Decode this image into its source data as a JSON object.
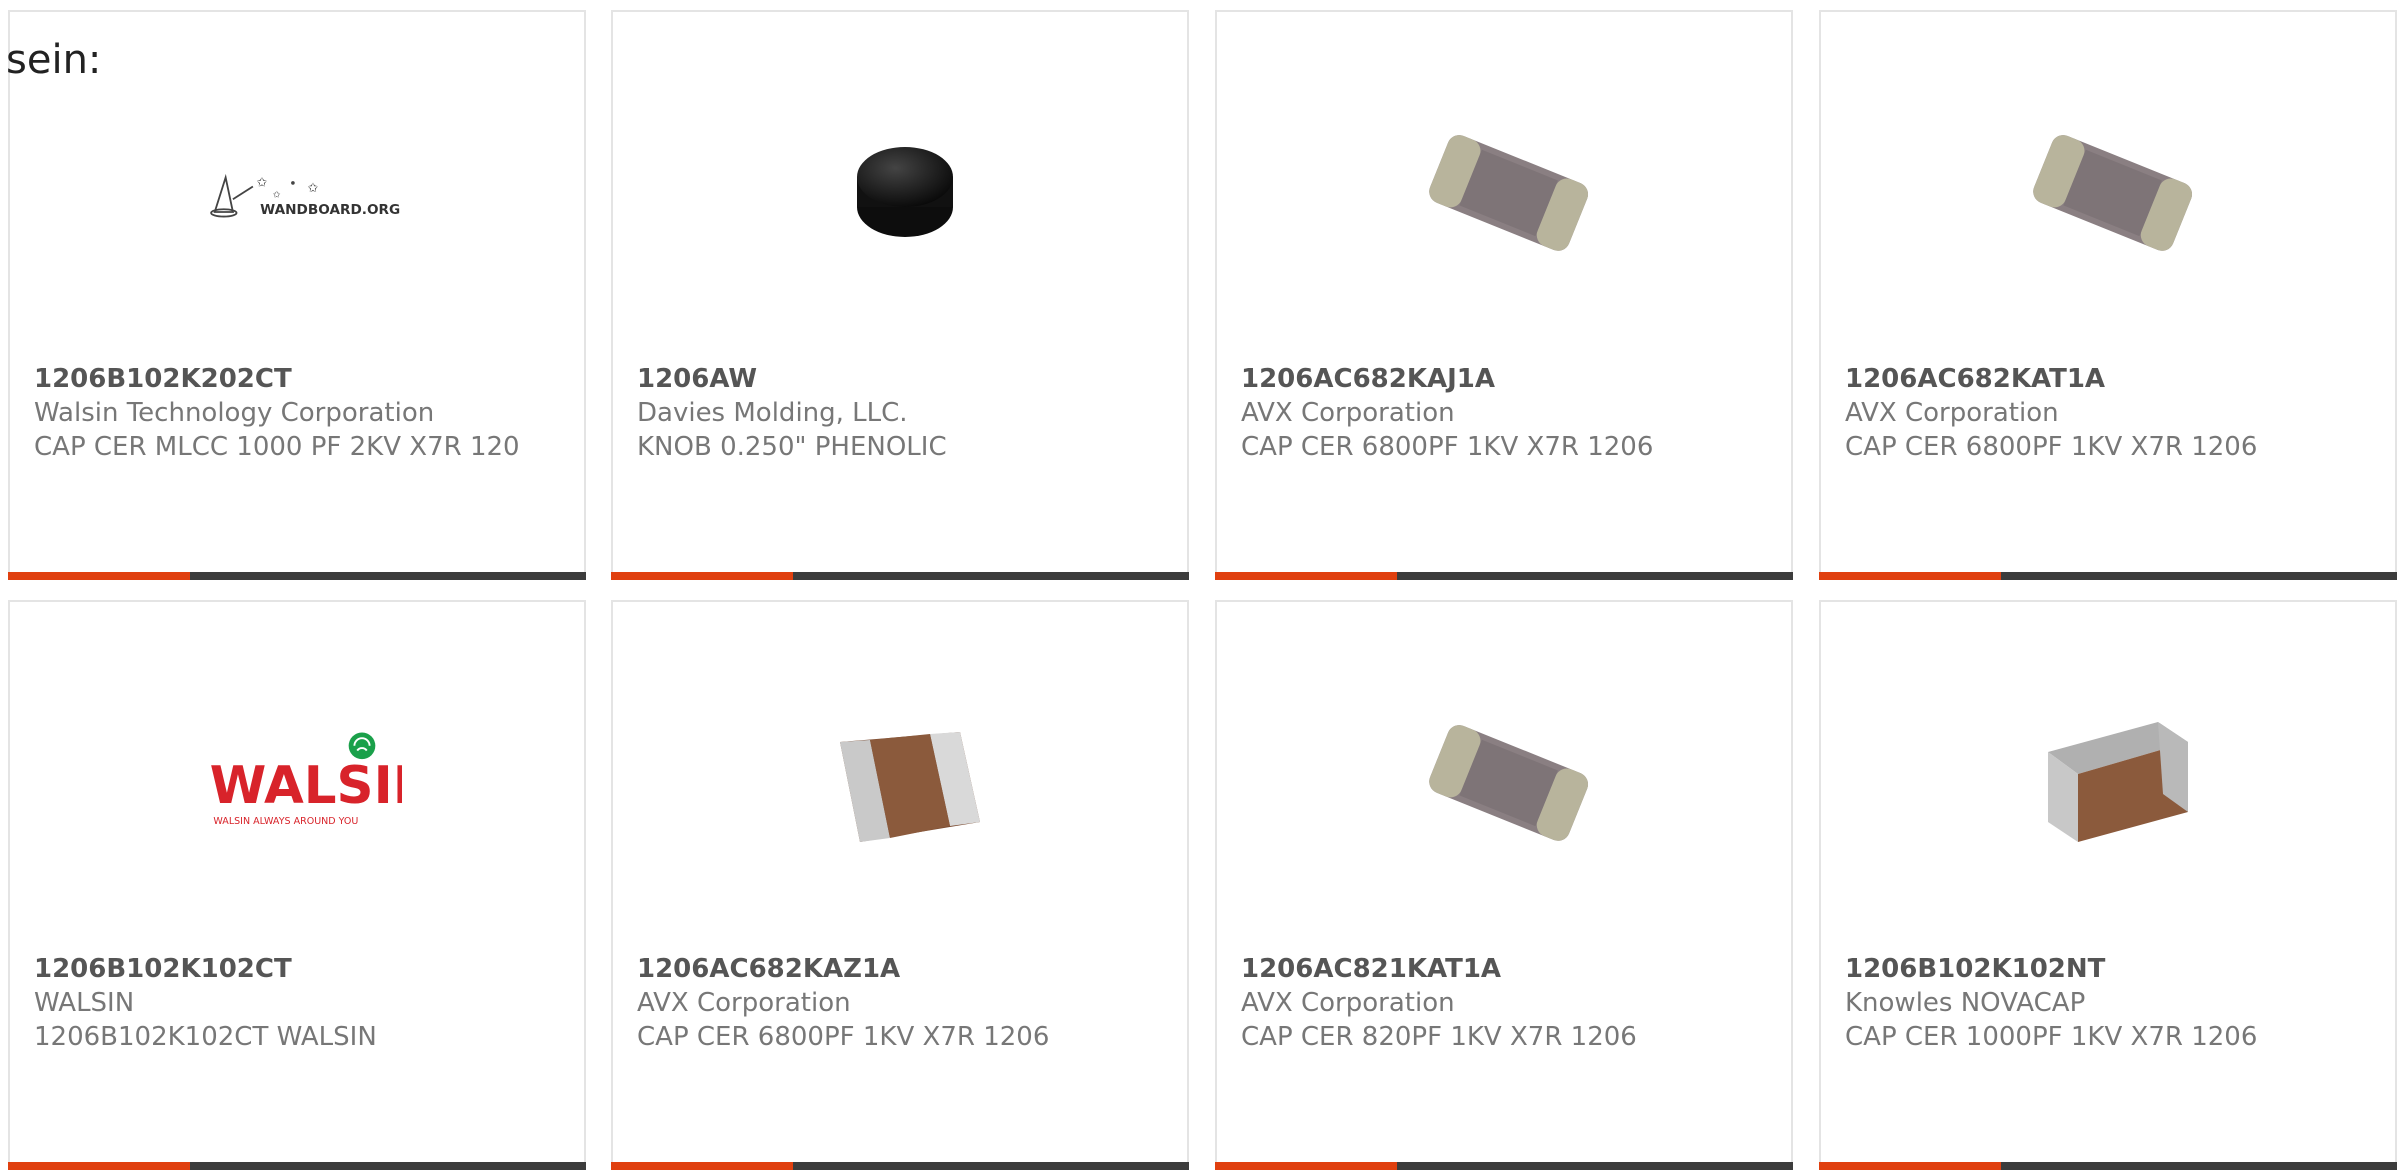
{
  "intro_text": "sein:",
  "colors": {
    "accent": "#e0400f",
    "bar_dark": "#3c3c3c"
  },
  "cards": [
    {
      "part_number": "1206B102K202CT",
      "manufacturer": "Walsin Technology Corporation",
      "description": "CAP CER MLCC 1000 PF 2KV X7R 120",
      "image": "wandboard-logo",
      "logo_text": "WANDBOARD.ORG"
    },
    {
      "part_number": "1206AW",
      "manufacturer": "Davies Molding, LLC.",
      "description": "KNOB 0.250\" PHENOLIC",
      "image": "black-knob"
    },
    {
      "part_number": "1206AC682KAJ1A",
      "manufacturer": "AVX Corporation",
      "description": "CAP CER 6800PF 1KV X7R 1206",
      "image": "smd-capacitor-gray"
    },
    {
      "part_number": "1206AC682KAT1A",
      "manufacturer": "AVX Corporation",
      "description": "CAP CER 6800PF 1KV X7R 1206",
      "image": "smd-capacitor-gray"
    },
    {
      "part_number": "1206B102K102CT",
      "manufacturer": "WALSIN",
      "description": "1206B102K102CT WALSIN",
      "image": "walsin-logo",
      "logo_text": "WALSIN",
      "logo_tagline": "WALSIN ALWAYS AROUND YOU"
    },
    {
      "part_number": "1206AC682KAZ1A",
      "manufacturer": "AVX Corporation",
      "description": "CAP CER 6800PF 1KV X7R 1206",
      "image": "smd-capacitor-brown"
    },
    {
      "part_number": "1206AC821KAT1A",
      "manufacturer": "AVX Corporation",
      "description": "CAP CER 820PF 1KV X7R 1206",
      "image": "smd-capacitor-gray"
    },
    {
      "part_number": "1206B102K102NT",
      "manufacturer": "Knowles NOVACAP",
      "description": "CAP CER 1000PF 1KV X7R 1206",
      "image": "smd-capacitor-brown"
    }
  ]
}
